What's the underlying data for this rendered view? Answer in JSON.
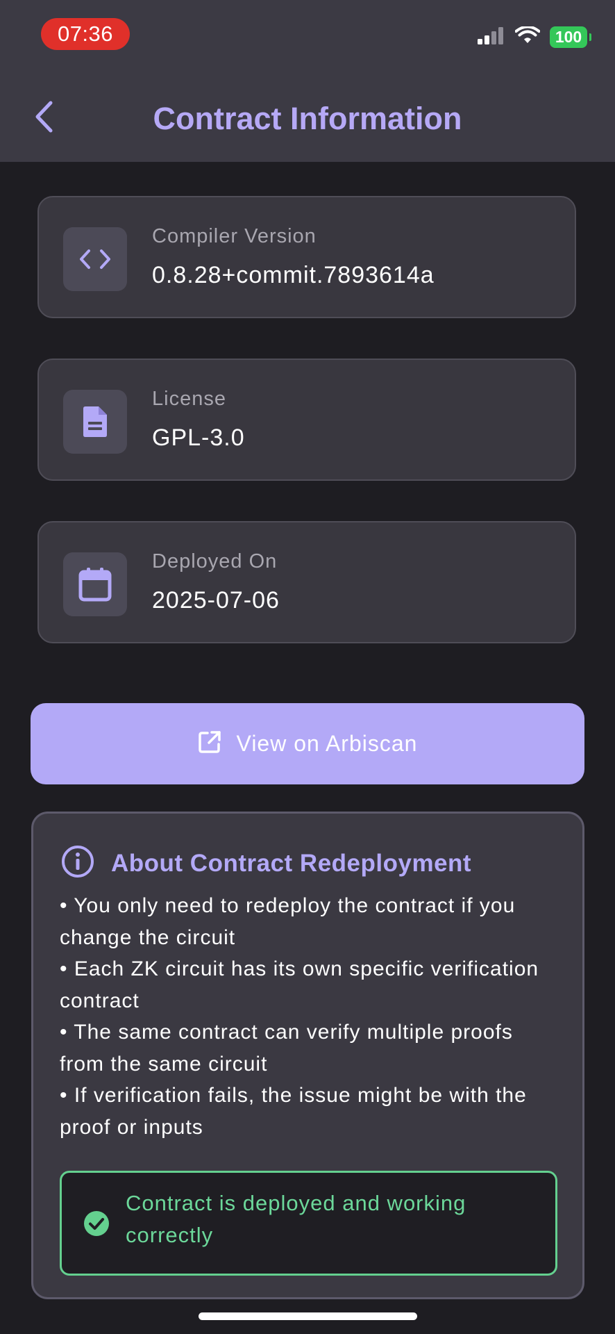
{
  "status_bar": {
    "time": "07:36",
    "battery": "100"
  },
  "nav": {
    "title": "Contract Information",
    "back_icon": "chevron-left-icon"
  },
  "cards": [
    {
      "label": "Compiler Version",
      "value": "0.8.28+commit.7893614a",
      "icon": "code-icon"
    },
    {
      "label": "License",
      "value": "GPL-3.0",
      "icon": "document-icon"
    },
    {
      "label": "Deployed On",
      "value": "2025-07-06",
      "icon": "calendar-icon"
    }
  ],
  "arbiscan_button": {
    "label": "View on Arbiscan",
    "icon": "external-link-icon"
  },
  "about": {
    "title": "About Contract Redeployment",
    "icon": "info-icon",
    "items": [
      "• You only need to redeploy the contract if you change the circuit",
      "• Each ZK circuit has its own specific verification contract",
      "• The same contract can verify multiple proofs from the same circuit",
      "• If verification fails, the issue might be with the proof or inputs"
    ]
  },
  "status": {
    "text": "Contract is deployed and working correctly",
    "icon": "check-circle-icon"
  },
  "colors": {
    "accent": "#b3a9f7",
    "header_bg": "#3c3a44",
    "page_bg": "#1e1d22",
    "card_bg": "#39373f",
    "success": "#64d08f",
    "time_pill": "#e0302a",
    "battery": "#34c759"
  }
}
